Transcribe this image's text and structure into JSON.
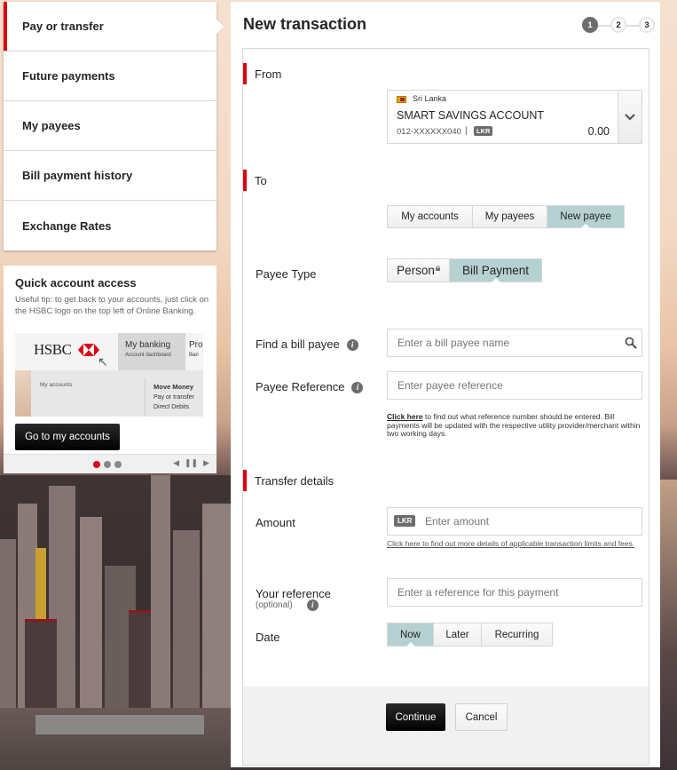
{
  "sidebar": {
    "items": [
      {
        "label": "Pay or transfer",
        "active": true
      },
      {
        "label": "Future payments",
        "active": false
      },
      {
        "label": "My payees",
        "active": false
      },
      {
        "label": "Bill payment history",
        "active": false
      },
      {
        "label": "Exchange Rates",
        "active": false
      }
    ]
  },
  "quick_access": {
    "title": "Quick account access",
    "tip": "Useful tip: to get back to your accounts, just click on the HSBC logo on the top left of Online Banking.",
    "preview": {
      "logo": "HSBC",
      "menu_title": "My banking",
      "menu_sub": "Account dashboard",
      "menu2_title": "Pro",
      "menu2_sub": "Ban",
      "my_accounts": "My accounts",
      "move_money": "Move Money",
      "move_links": [
        "Pay or transfer",
        "Direct Debits"
      ]
    },
    "button_label": "Go to my accounts",
    "carousel": {
      "total": 3,
      "active": 1
    },
    "controls": {
      "prev": "◀",
      "pause": "❚❚",
      "next": "▶"
    }
  },
  "main": {
    "title": "New transaction",
    "steps": [
      "1",
      "2",
      "3"
    ],
    "current_step": 1,
    "from": {
      "section_label": "From",
      "account": {
        "country": "Sri Lanka",
        "name": "SMART SAVINGS ACCOUNT",
        "number": "012-XXXXXX040",
        "separator": "|",
        "currency": "LKR",
        "balance": "0.00"
      }
    },
    "to": {
      "section_label": "To",
      "tabs": [
        {
          "label": "My accounts",
          "selected": false
        },
        {
          "label": "My payees",
          "selected": false
        },
        {
          "label": "New payee",
          "selected": true
        }
      ],
      "payee_type_label": "Payee Type",
      "payee_types": [
        {
          "label": "Person",
          "selected": false,
          "locked": true
        },
        {
          "label": "Bill Payment",
          "selected": true,
          "locked": false
        }
      ],
      "find_payee_label": "Find a bill payee",
      "find_payee_placeholder": "Enter a bill payee name",
      "payee_reference_label": "Payee Reference",
      "payee_reference_placeholder": "Enter payee reference",
      "note_link": "Click here",
      "note_text": " to find out what reference number should be entered. Bill payments will be updated with the respective utility provider/merchant within two working days."
    },
    "transfer": {
      "section_label": "Transfer details",
      "amount_label": "Amount",
      "amount_currency": "LKR",
      "amount_placeholder": "Enter amount",
      "limits_link": "Click here to find out more details of applicable transaction limits and fees.",
      "reference_label": "Your reference",
      "reference_optional": "(optional)",
      "reference_placeholder": "Enter a reference for this payment",
      "date_label": "Date",
      "date_options": [
        {
          "label": "Now",
          "selected": true
        },
        {
          "label": "Later",
          "selected": false
        },
        {
          "label": "Recurring",
          "selected": false
        }
      ]
    },
    "actions": {
      "continue_label": "Continue",
      "cancel_label": "Cancel"
    }
  },
  "colors": {
    "accent_red": "#db0011",
    "selected_teal": "#b6d1d2",
    "primary_button": "#000000"
  }
}
